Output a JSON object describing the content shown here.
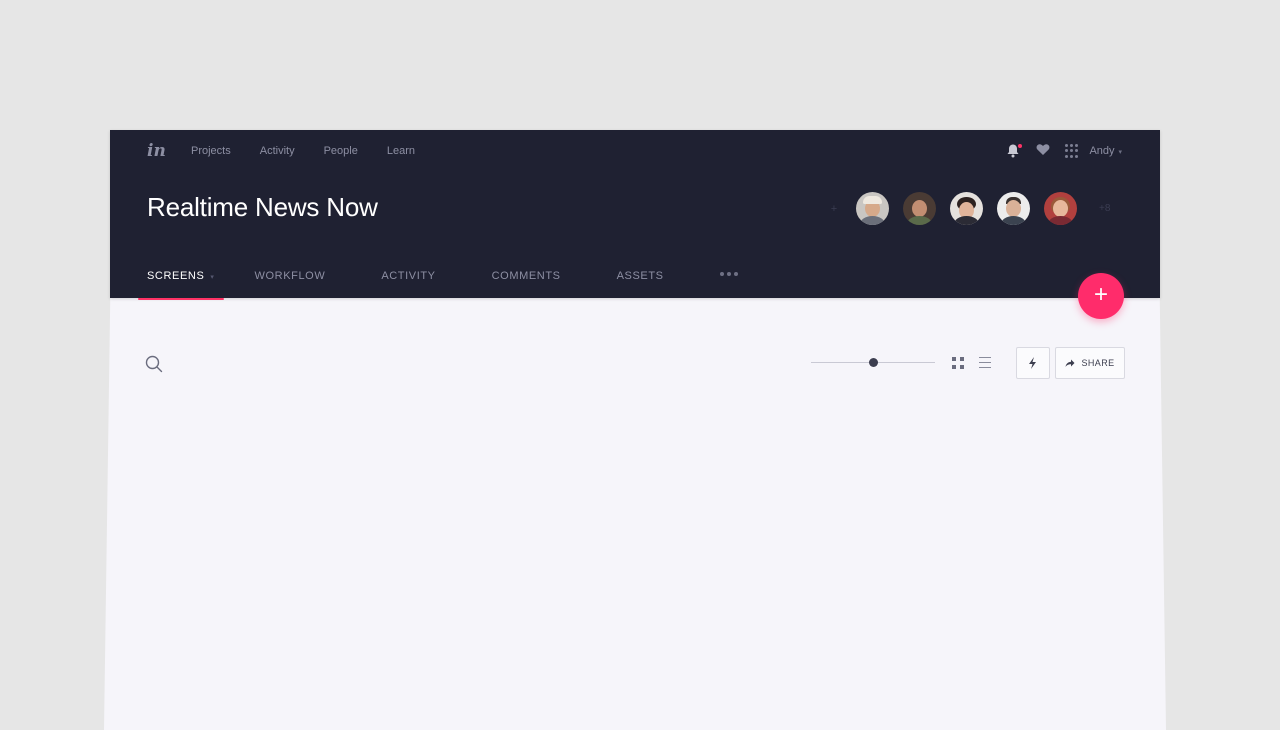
{
  "nav": {
    "logo": "in",
    "items": [
      "Projects",
      "Activity",
      "People",
      "Learn"
    ],
    "user": "Andy"
  },
  "project": {
    "title": "Realtime News Now",
    "avatars_more": "+8",
    "avatar_add": "+"
  },
  "tabs": [
    {
      "label": "SCREENS",
      "active": true
    },
    {
      "label": "WORKFLOW"
    },
    {
      "label": "ACTIVITY"
    },
    {
      "label": "COMMENTS"
    },
    {
      "label": "ASSETS"
    }
  ],
  "toolbar": {
    "zoom_level": 0.5,
    "share_label": "SHARE"
  },
  "fab_label": "+",
  "colors": {
    "header_bg": "#1f2132",
    "accent": "#ff2c6b",
    "content_bg": "#f6f5fa"
  },
  "icons": [
    "search-icon",
    "bell-icon",
    "heart-icon",
    "apps-icon",
    "grid-view-icon",
    "list-view-icon",
    "lightning-icon",
    "share-arrow-icon"
  ]
}
